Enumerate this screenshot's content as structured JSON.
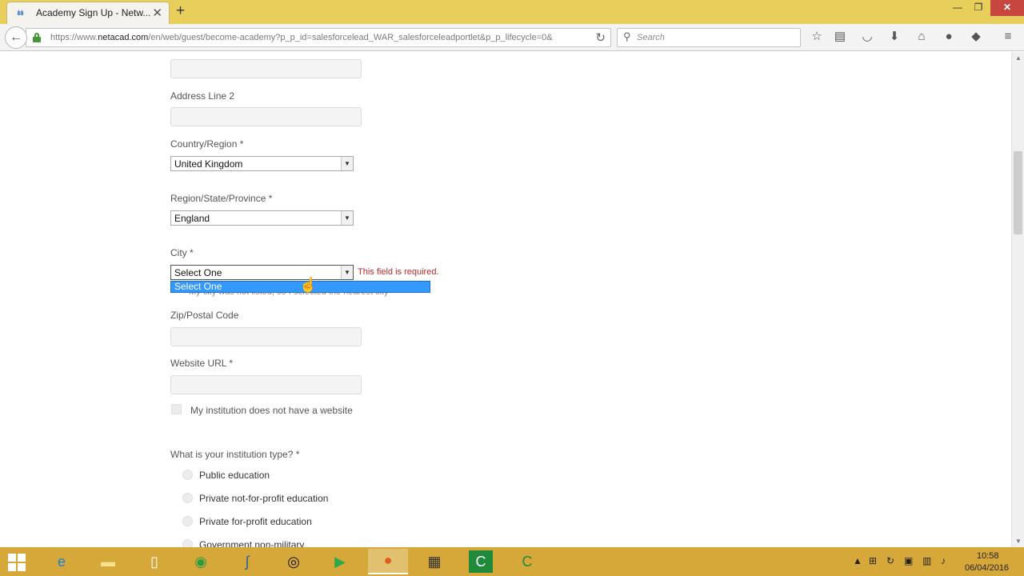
{
  "browser": {
    "tab_title": "Academy Sign Up - Netw...",
    "tab_favicon": "cisco",
    "url_prefix": "https://www.",
    "url_domain": "netacad.com",
    "url_rest": "/en/web/guest/become-academy?p_p_id=salesforcelead_WAR_salesforceleadportlet&p_p_lifecycle=0&",
    "search_placeholder": "Search"
  },
  "form": {
    "address_line_2_label": "Address Line 2",
    "country_label": "Country/Region *",
    "country_value": "United Kingdom",
    "region_label": "Region/State/Province *",
    "region_value": "England",
    "city_label": "City *",
    "city_value": "Select One",
    "city_error": "This field is required.",
    "city_dropdown_option": "Select One",
    "city_hidden_checkbox_text": "My city was not listed, so I selected the nearest city",
    "zip_label": "Zip/Postal Code",
    "website_label": "Website URL *",
    "no_website_label": "My institution does not have a website",
    "institution_type_label": "What is your institution type? *",
    "institution_types": [
      "Public education",
      "Private not-for-profit education",
      "Private for-profit education",
      "Government non-military"
    ]
  },
  "taskbar": {
    "time": "10:58",
    "date": "06/04/2016"
  }
}
